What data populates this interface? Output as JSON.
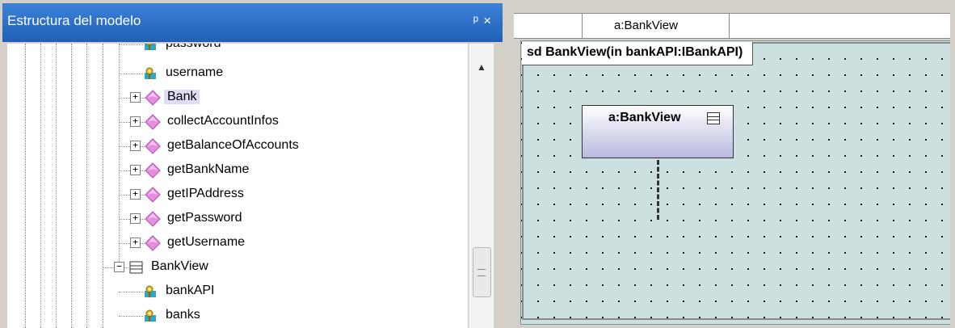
{
  "panel": {
    "title": "Estructura del modelo",
    "pin_icon": "pin-icon",
    "close_icon": "close-icon",
    "pin_glyph": "ᵖ",
    "close_glyph": "×"
  },
  "tree": {
    "items": [
      {
        "label": "password",
        "type": "property",
        "expander": ""
      },
      {
        "label": "username",
        "type": "property",
        "expander": ""
      },
      {
        "label": "Bank",
        "type": "class-diamond",
        "expander": "+",
        "selected": true
      },
      {
        "label": "collectAccountInfos",
        "type": "class-diamond",
        "expander": "+"
      },
      {
        "label": "getBalanceOfAccounts",
        "type": "class-diamond",
        "expander": "+"
      },
      {
        "label": "getBankName",
        "type": "class-diamond",
        "expander": "+"
      },
      {
        "label": "getIPAddress",
        "type": "class-diamond",
        "expander": "+"
      },
      {
        "label": "getPassword",
        "type": "class-diamond",
        "expander": "+"
      },
      {
        "label": "getUsername",
        "type": "class-diamond",
        "expander": "+"
      },
      {
        "label": "BankView",
        "type": "class-box",
        "expander": "−"
      },
      {
        "label": "bankAPI",
        "type": "property",
        "expander": ""
      },
      {
        "label": "banks",
        "type": "property",
        "expander": ""
      }
    ]
  },
  "diagram": {
    "tab_label": "a:BankView",
    "frame_label": "sd BankView(in bankAPI:IBankAPI)",
    "lifeline_name": "a:BankView",
    "colors": {
      "canvas": "#cde0e0",
      "lifeline_bottom": "#b8b8e0",
      "titlebar": "#2a6cc8"
    }
  }
}
